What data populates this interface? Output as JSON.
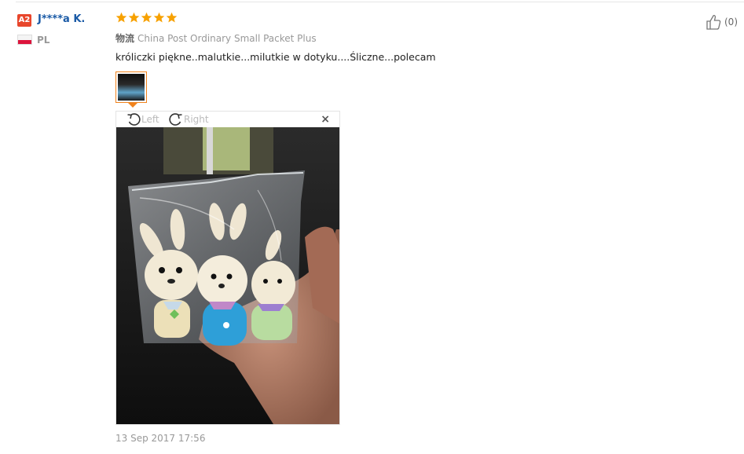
{
  "user": {
    "badge": "A2",
    "name": "J****a K.",
    "country": "PL"
  },
  "review": {
    "rating": 5,
    "stars_max": 5,
    "shipping_label": "物流",
    "shipping_method": "China Post Ordinary Small Packet Plus",
    "text": "króliczki piękne..malutkie...milutkie w dotyku....Śliczne...polecam",
    "date": "13 Sep 2017 17:56"
  },
  "viewer": {
    "rotate_left_label": "Left",
    "rotate_right_label": "Right",
    "close_glyph": "×"
  },
  "helpful": {
    "count_text": "(0)"
  },
  "colors": {
    "accent": "#f0831d",
    "star": "#f7a100",
    "username": "#1a5aa6",
    "badge": "#e8462c"
  },
  "icons": [
    "thumbs-up-icon",
    "rotate-left-icon",
    "rotate-right-icon",
    "close-icon",
    "star-icon",
    "flag-pl-icon"
  ]
}
